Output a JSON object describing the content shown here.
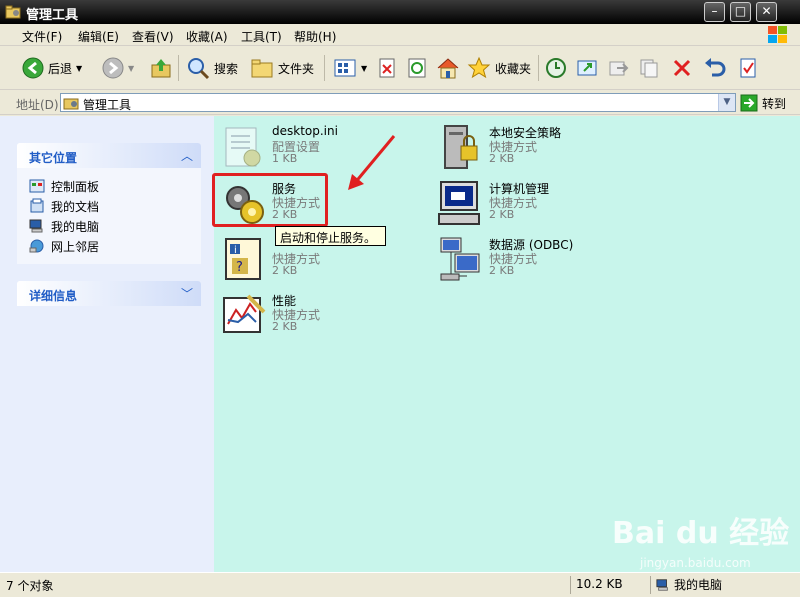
{
  "window": {
    "title": "管理工具"
  },
  "menu": [
    "文件(F)",
    "编辑(E)",
    "查看(V)",
    "收藏(A)",
    "工具(T)",
    "帮助(H)"
  ],
  "toolbar": {
    "back": "后退",
    "search": "搜索",
    "folders": "文件夹",
    "favorites": "收藏夹"
  },
  "address": {
    "label": "地址(D)",
    "value": "管理工具",
    "go": "转到"
  },
  "left_panels": {
    "other_places": {
      "title": "其它位置",
      "links": [
        "控制面板",
        "我的文档",
        "我的电脑",
        "网上邻居"
      ]
    },
    "details": {
      "title": "详细信息"
    }
  },
  "files": [
    {
      "name": "desktop.ini",
      "type": "配置设置",
      "size": "1 KB"
    },
    {
      "name": "服务",
      "type": "快捷方式",
      "size": "2 KB"
    },
    {
      "name": "",
      "type": "快捷方式",
      "size": "2 KB"
    },
    {
      "name": "性能",
      "type": "快捷方式",
      "size": "2 KB"
    },
    {
      "name": "本地安全策略",
      "type": "快捷方式",
      "size": "2 KB"
    },
    {
      "name": "计算机管理",
      "type": "快捷方式",
      "size": "2 KB"
    },
    {
      "name": "数据源 (ODBC)",
      "type": "快捷方式",
      "size": "2 KB"
    }
  ],
  "tooltip": "启动和停止服务。",
  "status": {
    "count": "7 个对象",
    "size": "10.2 KB",
    "location": "我的电脑"
  },
  "watermark": {
    "brand": "Bai du 经验",
    "url": "jingyan.baidu.com"
  },
  "colors": {
    "content_bg": "#c8f5eb",
    "panel_title": "#215dc6",
    "highlight": "#e02020"
  }
}
